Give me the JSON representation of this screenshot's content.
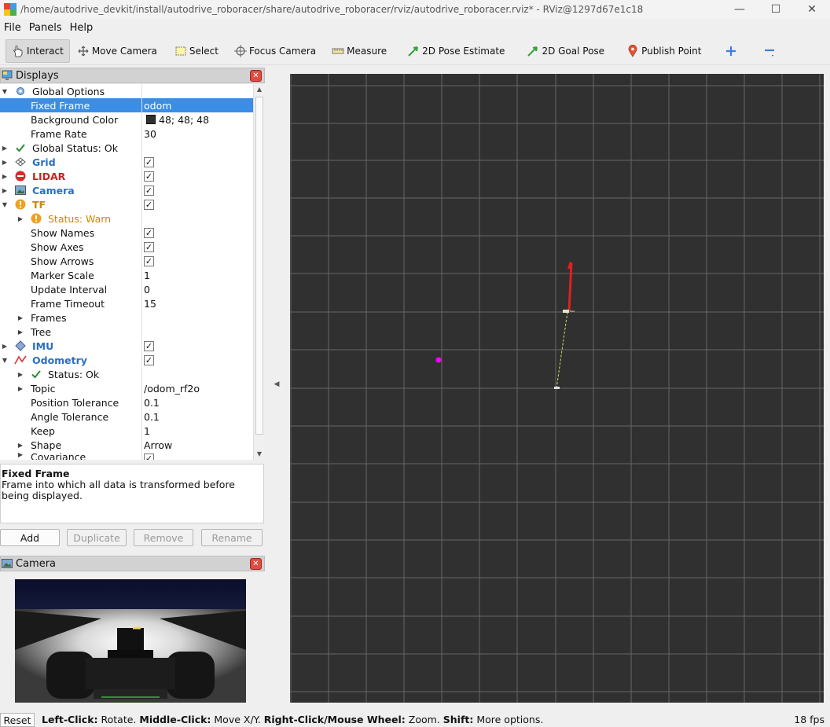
{
  "window": {
    "title": "/home/autodrive_devkit/install/autodrive_roboracer/share/autodrive_roboracer/rviz/autodrive_roboracer.rviz* - RViz@1297d67e1c18",
    "minimize": "—",
    "maximize": "☐",
    "close": "✕"
  },
  "menu": {
    "file": "File",
    "panels": "Panels",
    "help": "Help"
  },
  "toolbar": {
    "interact": "Interact",
    "move_camera": "Move Camera",
    "select": "Select",
    "focus_camera": "Focus Camera",
    "measure": "Measure",
    "pose_estimate": "2D Pose Estimate",
    "goal_pose": "2D Goal Pose",
    "publish_point": "Publish Point"
  },
  "displays_panel": {
    "title": "Displays",
    "rows": {
      "global_options": "Global Options",
      "fixed_frame": "Fixed Frame",
      "fixed_frame_value": "odom",
      "background_color": "Background Color",
      "background_color_value": "48; 48; 48",
      "frame_rate": "Frame Rate",
      "frame_rate_value": "30",
      "global_status": "Global Status: Ok",
      "grid": "Grid",
      "lidar": "LIDAR",
      "camera": "Camera",
      "tf": "TF",
      "tf_status": "Status: Warn",
      "show_names": "Show Names",
      "show_axes": "Show Axes",
      "show_arrows": "Show Arrows",
      "marker_scale": "Marker Scale",
      "marker_scale_value": "1",
      "update_interval": "Update Interval",
      "update_interval_value": "0",
      "frame_timeout": "Frame Timeout",
      "frame_timeout_value": "15",
      "frames": "Frames",
      "tree": "Tree",
      "imu": "IMU",
      "odometry": "Odometry",
      "odom_status": "Status: Ok",
      "topic": "Topic",
      "topic_value": "/odom_rf2o",
      "position_tolerance": "Position Tolerance",
      "position_tolerance_value": "0.1",
      "angle_tolerance": "Angle Tolerance",
      "angle_tolerance_value": "0.1",
      "keep": "Keep",
      "keep_value": "1",
      "shape": "Shape",
      "shape_value": "Arrow",
      "covariance": "Covariance"
    },
    "check": "✓"
  },
  "description": {
    "title": "Fixed Frame",
    "text": "Frame into which all data is transformed before being displayed."
  },
  "buttons": {
    "add": "Add",
    "duplicate": "Duplicate",
    "remove": "Remove",
    "rename": "Rename"
  },
  "camera_panel": {
    "title": "Camera"
  },
  "statusbar": {
    "reset": "Reset",
    "left_click": "Left-Click:",
    "left_click_action": " Rotate. ",
    "middle_click": "Middle-Click:",
    "middle_click_action": " Move X/Y. ",
    "right_click": "Right-Click/Mouse Wheel:",
    "right_click_action": " Zoom. ",
    "shift": "Shift:",
    "shift_action": " More options.",
    "fps": "18 fps"
  },
  "colors": {
    "viewport_bg": "#303030",
    "selection": "#3a8ee6",
    "display_blue": "#2a6fc2",
    "lidar_red": "#cc2222",
    "warn_orange": "#cc8800",
    "magenta_point": "#ff00ff"
  }
}
